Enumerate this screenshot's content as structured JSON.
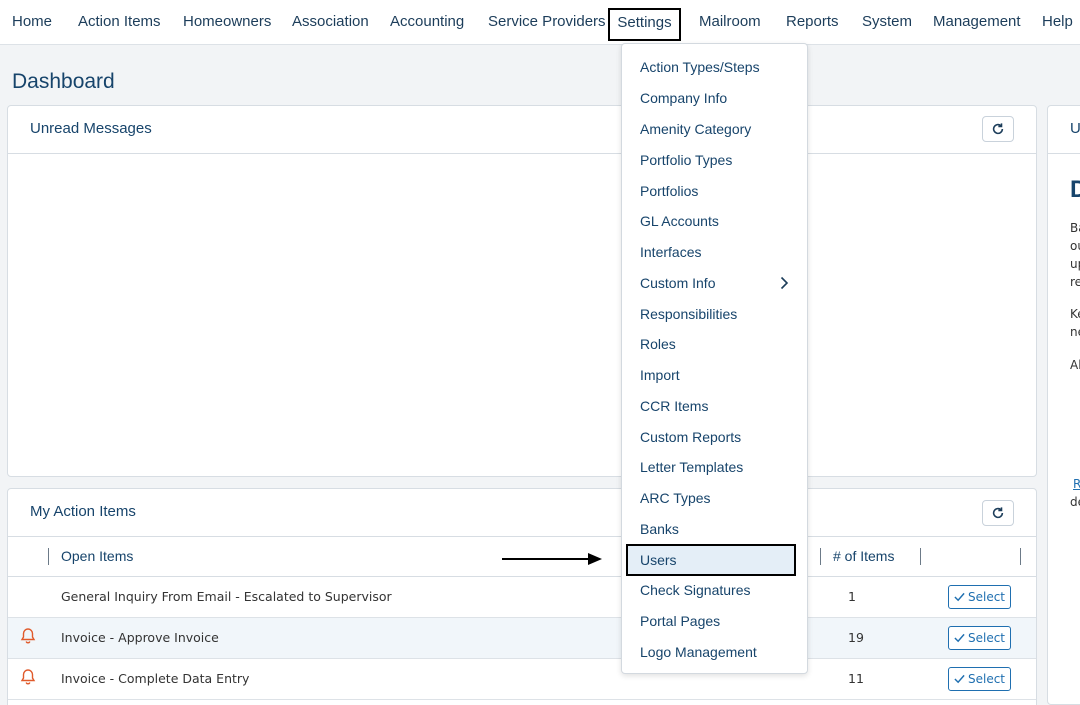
{
  "nav": {
    "items": [
      "Home",
      "Action Items",
      "Homeowners",
      "Association",
      "Accounting",
      "Service Providers",
      "Settings",
      "Mailroom",
      "Reports",
      "System",
      "Management",
      "Help"
    ]
  },
  "page": {
    "title": "Dashboard"
  },
  "unread": {
    "title": "Unread Messages"
  },
  "actions": {
    "title": "My Action Items",
    "col_open": "Open Items",
    "col_count": "# of Items",
    "select_label": "Select",
    "rows": [
      {
        "name": "General Inquiry From Email - Escalated to Supervisor",
        "count": "1",
        "bell": false
      },
      {
        "name": "Invoice - Approve Invoice",
        "count": "19",
        "bell": true
      },
      {
        "name": "Invoice - Complete Data Entry",
        "count": "11",
        "bell": true
      }
    ]
  },
  "side": {
    "title": "U",
    "heading": "D",
    "lines": [
      "Ba",
      "ou",
      "up",
      "re",
      "Ke",
      "ne",
      "Al"
    ],
    "link": "R",
    "tail": "de"
  },
  "settings_menu": {
    "items": [
      "Action Types/Steps",
      "Company Info",
      "Amenity Category",
      "Portfolio Types",
      "Portfolios",
      "GL Accounts",
      "Interfaces",
      "Custom Info",
      "Responsibilities",
      "Roles",
      "Import",
      "CCR Items",
      "Custom Reports",
      "Letter Templates",
      "ARC Types",
      "Banks",
      "Users",
      "Check Signatures",
      "Portal Pages",
      "Logo Management"
    ]
  },
  "colors": {
    "primary": "#17446b",
    "accent": "#1f6fb0",
    "bell": "#e05a2b"
  }
}
